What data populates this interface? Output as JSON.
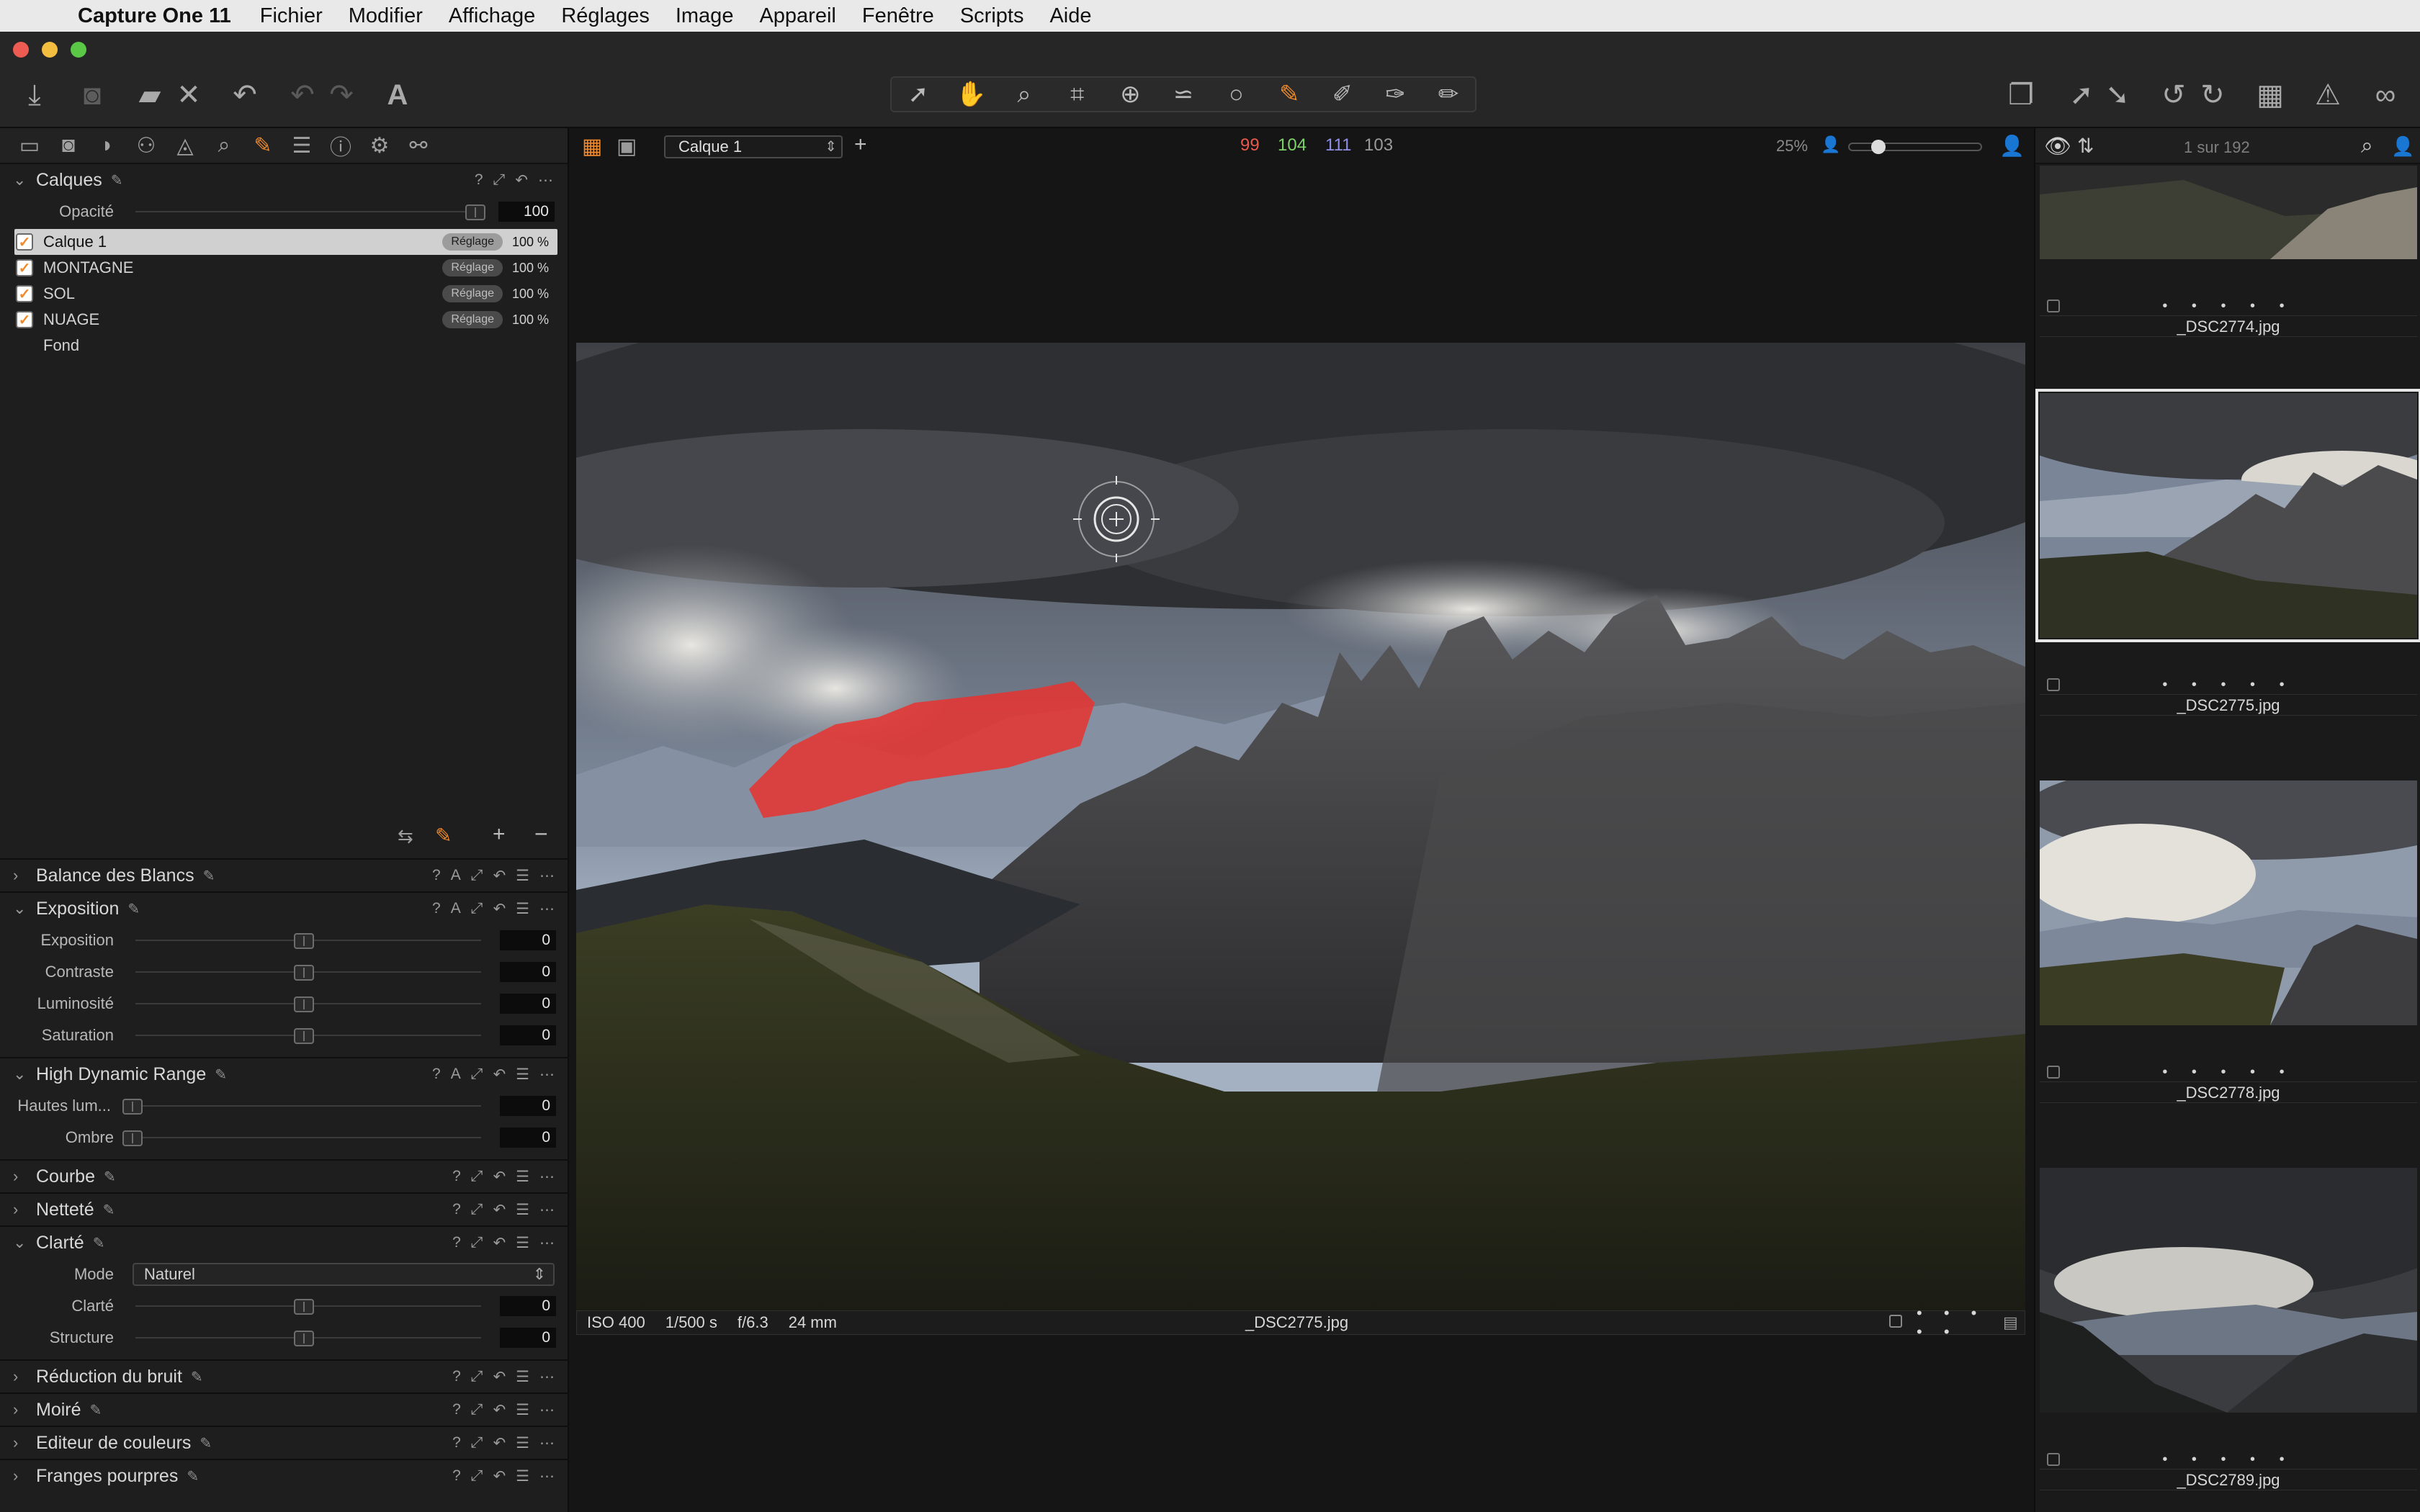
{
  "menubar": {
    "app": "Capture One 11",
    "items": [
      "Fichier",
      "Modifier",
      "Affichage",
      "Réglages",
      "Image",
      "Appareil",
      "Fenêtre",
      "Scripts",
      "Aide"
    ]
  },
  "toolbar": {
    "font_tool": "A"
  },
  "layers": {
    "title": "Calques",
    "opacity_label": "Opacité",
    "opacity_value": "100",
    "rows": [
      {
        "name": "Calque 1",
        "badge": "Réglage",
        "pct": "100 %",
        "checked": true
      },
      {
        "name": "MONTAGNE",
        "badge": "Réglage",
        "pct": "100 %",
        "checked": true
      },
      {
        "name": "SOL",
        "badge": "Réglage",
        "pct": "100 %",
        "checked": true
      },
      {
        "name": "NUAGE",
        "badge": "Réglage",
        "pct": "100 %",
        "checked": true
      }
    ],
    "background": "Fond"
  },
  "tools": {
    "white_balance": "Balance des Blancs",
    "exposure": {
      "title": "Exposition",
      "rows": [
        {
          "label": "Exposition",
          "value": "0"
        },
        {
          "label": "Contraste",
          "value": "0"
        },
        {
          "label": "Luminosité",
          "value": "0"
        },
        {
          "label": "Saturation",
          "value": "0"
        }
      ]
    },
    "hdr": {
      "title": "High Dynamic Range",
      "rows": [
        {
          "label": "Hautes lum...",
          "value": "0"
        },
        {
          "label": "Ombre",
          "value": "0"
        }
      ]
    },
    "curve": "Courbe",
    "sharpness": "Netteté",
    "clarity": {
      "title": "Clarté",
      "mode_label": "Mode",
      "mode_value": "Naturel",
      "rows": [
        {
          "label": "Clarté",
          "value": "0"
        },
        {
          "label": "Structure",
          "value": "0"
        }
      ]
    },
    "noise": "Réduction du bruit",
    "moire": "Moiré",
    "color_editor": "Editeur de couleurs",
    "fringe": "Franges pourpres"
  },
  "viewer": {
    "layer_select": "Calque 1",
    "rgb": {
      "r": "99",
      "g": "104",
      "b": "111",
      "l": "103"
    },
    "zoom": "25%",
    "info": {
      "iso": "ISO 400",
      "shutter": "1/500 s",
      "aperture": "f/6.3",
      "focal": "24 mm",
      "filename": "_DSC2775.jpg"
    }
  },
  "browser": {
    "counter": "1 sur 192",
    "thumbs": [
      {
        "name": "_DSC2774.jpg",
        "stars": "• • • • •"
      },
      {
        "name": "_DSC2775.jpg",
        "stars": "• • • • •"
      },
      {
        "name": "_DSC2778.jpg",
        "stars": "• • • • •"
      },
      {
        "name": "_DSC2789.jpg",
        "stars": "• • • • •"
      }
    ]
  },
  "colors": {
    "accent": "#ef8a2c",
    "red": "#e85a4a",
    "green": "#7fd16a",
    "blue": "#8f8fe6"
  }
}
